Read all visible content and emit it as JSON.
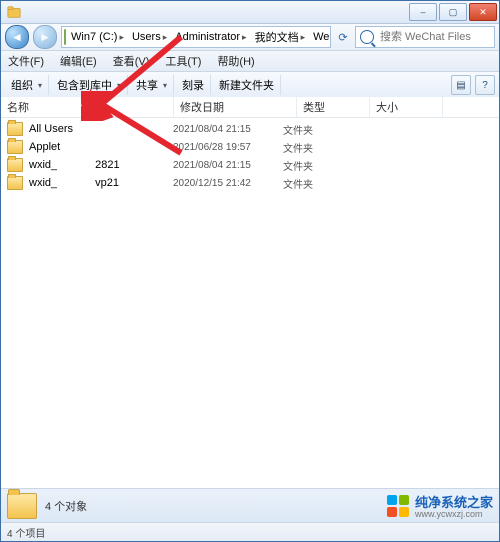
{
  "window": {
    "title": ""
  },
  "win_buttons": {
    "min": "–",
    "max": "▢",
    "close": "✕"
  },
  "nav": {
    "back_glyph": "◄",
    "fwd_glyph": "►",
    "refresh_glyph": "⟳"
  },
  "breadcrumb": [
    "Win7 (C:)",
    "Users",
    "Administrator",
    "我的文档",
    "WeChat Files"
  ],
  "search": {
    "placeholder": "搜索 WeChat Files"
  },
  "menu": [
    "文件(F)",
    "编辑(E)",
    "查看(V)",
    "工具(T)",
    "帮助(H)"
  ],
  "toolbar": {
    "organize": "组织",
    "include": "包含到库中",
    "share": "共享",
    "burn": "刻录",
    "newfolder": "新建文件夹",
    "dd_glyph": "▾",
    "view_glyph": "▤",
    "help_glyph": "?"
  },
  "columns": {
    "name": "名称",
    "date": "修改日期",
    "type": "类型",
    "size": "大小"
  },
  "rows": [
    {
      "name": "All Users",
      "date": "2021/08/04 21:15",
      "type": "文件夹"
    },
    {
      "name": "Applet",
      "date": "2021/06/28 19:57",
      "type": "文件夹"
    },
    {
      "name_prefix": "wxid_",
      "name_suffix": "2821",
      "censored": true,
      "date": "2021/08/04 21:15",
      "type": "文件夹"
    },
    {
      "name_prefix": "wxid_",
      "name_suffix": "vp21",
      "censored": true,
      "date": "2020/12/15 21:42",
      "type": "文件夹"
    }
  ],
  "preview": {
    "label": "4 个对象"
  },
  "status": {
    "text": "4 个项目"
  },
  "watermark": {
    "brand": "纯净系统之家",
    "url": "www.ycwxzj.com"
  },
  "colors": {
    "arrow": "#e4262f",
    "logo": [
      "#00a4ef",
      "#7fba00",
      "#f25022",
      "#ffb900"
    ]
  }
}
